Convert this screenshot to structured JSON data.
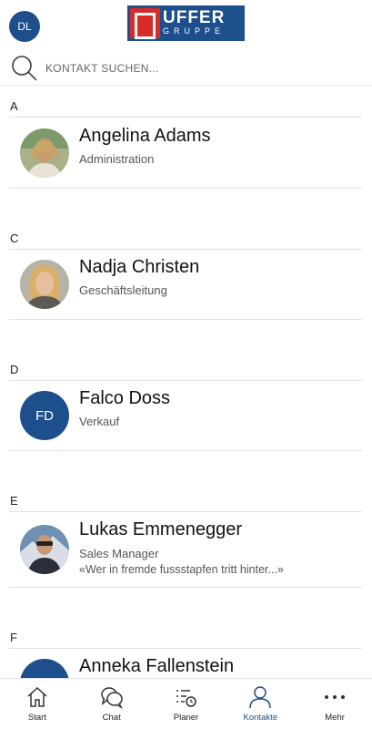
{
  "header": {
    "user_initials": "DL",
    "logo_main": "UFFER",
    "logo_sub": "GRUPPE"
  },
  "search": {
    "placeholder": "KONTAKT SUCHEN..."
  },
  "sections": [
    {
      "letter": "A",
      "contacts": [
        {
          "name": "Angelina Adams",
          "role": "Administration",
          "avatar": "photo"
        }
      ]
    },
    {
      "letter": "C",
      "contacts": [
        {
          "name": "Nadja Christen",
          "role": "Geschäftsleitung",
          "avatar": "photo"
        }
      ]
    },
    {
      "letter": "D",
      "contacts": [
        {
          "name": "Falco Doss",
          "role": "Verkauf",
          "avatar": "initials",
          "initials": "FD"
        }
      ]
    },
    {
      "letter": "E",
      "contacts": [
        {
          "name": "Lukas Emmenegger",
          "role": "Sales Manager",
          "status": "«Wer in fremde fussstapfen tritt hinter...»",
          "avatar": "photo"
        }
      ]
    },
    {
      "letter": "F",
      "contacts": [
        {
          "name": "Anneka Fallenstein",
          "avatar": "initials"
        }
      ]
    }
  ],
  "tabs": [
    {
      "label": "Start",
      "icon": "home-icon",
      "active": false
    },
    {
      "label": "Chat",
      "icon": "chat-icon",
      "active": false
    },
    {
      "label": "Planer",
      "icon": "planner-icon",
      "active": false
    },
    {
      "label": "Kontakte",
      "icon": "contacts-icon",
      "active": true
    },
    {
      "label": "Mehr",
      "icon": "more-icon",
      "active": false
    }
  ],
  "colors": {
    "brand": "#1d4f8c",
    "logo_red": "#d92a2a",
    "divider": "#e1e1e1"
  }
}
